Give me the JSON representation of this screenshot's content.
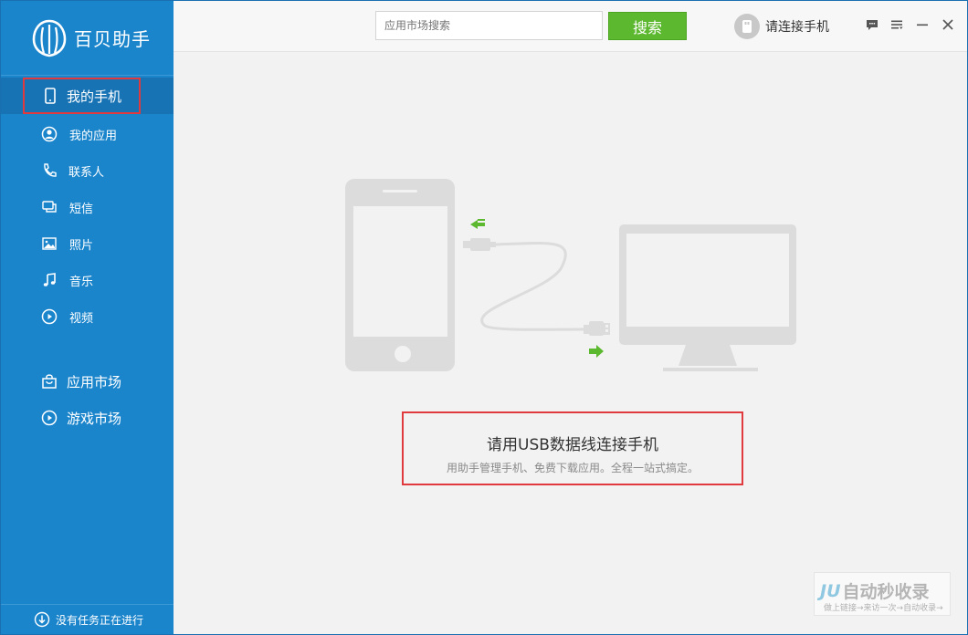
{
  "app": {
    "name": "百贝助手"
  },
  "sidebar": {
    "items": [
      {
        "label": "我的手机",
        "icon": "phone-icon",
        "active": true
      },
      {
        "label": "我的应用",
        "icon": "user-circle-icon"
      },
      {
        "label": "联系人",
        "icon": "phone-handset-icon"
      },
      {
        "label": "短信",
        "icon": "message-icon"
      },
      {
        "label": "照片",
        "icon": "image-icon"
      },
      {
        "label": "音乐",
        "icon": "music-note-icon"
      },
      {
        "label": "视频",
        "icon": "play-circle-icon"
      }
    ],
    "market_items": [
      {
        "label": "应用市场",
        "icon": "shopping-bag-icon"
      },
      {
        "label": "游戏市场",
        "icon": "play-circle-icon"
      }
    ],
    "status": "没有任务正在进行"
  },
  "topbar": {
    "search_placeholder": "应用市场搜索",
    "search_button": "搜索",
    "connect_label": "请连接手机"
  },
  "main": {
    "title": "请用USB数据线连接手机",
    "subtitle": "用助手管理手机、免费下载应用。全程一站式搞定。"
  },
  "watermark": {
    "main": "自动秒收录",
    "prefix": "JU",
    "sub": "做上链接→来访一次→自动收录→"
  },
  "colors": {
    "sidebar": "#1b85cc",
    "accent_green": "#5cb82e",
    "highlight_red": "#e0393e"
  }
}
